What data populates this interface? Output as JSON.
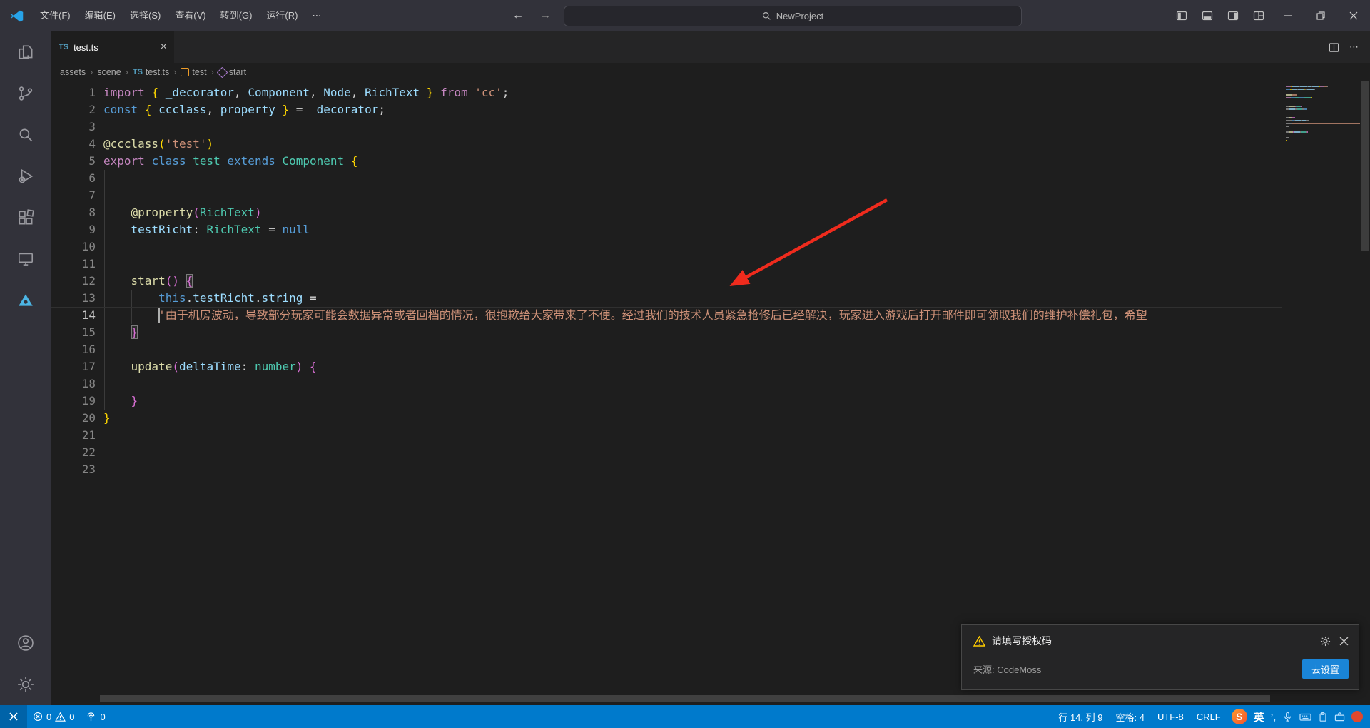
{
  "window": {
    "menus": [
      "文件(F)",
      "编辑(E)",
      "选择(S)",
      "查看(V)",
      "转到(G)",
      "运行(R)"
    ],
    "menu_overflow": "⋯",
    "command_center": "NewProject"
  },
  "tab": {
    "label": "test.ts",
    "icon": "TS"
  },
  "editor_actions": {
    "more": "⋯"
  },
  "breadcrumbs": {
    "items": [
      {
        "label": "assets"
      },
      {
        "label": "scene"
      },
      {
        "label": "test.ts",
        "icon": "ts"
      },
      {
        "label": "test",
        "icon": "class"
      },
      {
        "label": "start",
        "icon": "method"
      }
    ]
  },
  "editor": {
    "current_line": 14,
    "cursor_col": 8,
    "lines": [
      {
        "n": 1,
        "t": [
          [
            "ctrl",
            "import "
          ],
          [
            "b1",
            "{"
          ],
          [
            "v",
            " _decorator"
          ],
          [
            "p",
            ","
          ],
          [
            "v",
            " Component"
          ],
          [
            "p",
            ","
          ],
          [
            "v",
            " Node"
          ],
          [
            "p",
            ","
          ],
          [
            "v",
            " RichText "
          ],
          [
            "b1",
            "}"
          ],
          [
            "ctrl",
            " from "
          ],
          [
            "s",
            "'cc'"
          ],
          [
            "p",
            ";"
          ]
        ]
      },
      {
        "n": 2,
        "t": [
          [
            "kw",
            "const "
          ],
          [
            "b1",
            "{ "
          ],
          [
            "v",
            "ccclass"
          ],
          [
            "p",
            ", "
          ],
          [
            "v",
            "property"
          ],
          [
            "b1",
            " }"
          ],
          [
            "p",
            " = "
          ],
          [
            "v",
            "_decorator"
          ],
          [
            "p",
            ";"
          ]
        ]
      },
      {
        "n": 3,
        "t": []
      },
      {
        "n": 4,
        "t": [
          [
            "fn",
            "@ccclass"
          ],
          [
            "b1",
            "("
          ],
          [
            "s",
            "'test'"
          ],
          [
            "b1",
            ")"
          ]
        ]
      },
      {
        "n": 5,
        "t": [
          [
            "ctrl",
            "export "
          ],
          [
            "kw",
            "class "
          ],
          [
            "ty",
            "test "
          ],
          [
            "kw",
            "extends "
          ],
          [
            "ty",
            "Component "
          ],
          [
            "b1",
            "{"
          ]
        ]
      },
      {
        "n": 6,
        "t": []
      },
      {
        "n": 7,
        "t": []
      },
      {
        "n": 8,
        "t": [
          [
            "p",
            "    "
          ],
          [
            "fn",
            "@property"
          ],
          [
            "b2",
            "("
          ],
          [
            "ty",
            "RichText"
          ],
          [
            "b2",
            ")"
          ]
        ]
      },
      {
        "n": 9,
        "t": [
          [
            "p",
            "    "
          ],
          [
            "v",
            "testRicht"
          ],
          [
            "p",
            ": "
          ],
          [
            "ty",
            "RichText"
          ],
          [
            "p",
            " = "
          ],
          [
            "kw",
            "null"
          ]
        ]
      },
      {
        "n": 10,
        "t": []
      },
      {
        "n": 11,
        "t": []
      },
      {
        "n": 12,
        "t": [
          [
            "p",
            "    "
          ],
          [
            "fn",
            "start"
          ],
          [
            "b2",
            "()"
          ],
          [
            "p",
            " "
          ],
          [
            "b2",
            "{",
            1
          ]
        ]
      },
      {
        "n": 13,
        "t": [
          [
            "p",
            "        "
          ],
          [
            "kw",
            "this"
          ],
          [
            "p",
            "."
          ],
          [
            "v",
            "testRicht"
          ],
          [
            "p",
            "."
          ],
          [
            "v",
            "string"
          ],
          [
            "p",
            " = "
          ]
        ]
      },
      {
        "n": 14,
        "t": [
          [
            "p",
            "        "
          ],
          [
            "s",
            "'由于机房波动，导致部分玩家可能会数据异常或者回档的情况，很抱歉给大家带来了不便。经过我们的技术人员紧急抢修后已经解决，玩家进入游戏后打开邮件即可领取我们的维护补偿礼包，希望"
          ]
        ]
      },
      {
        "n": 15,
        "t": [
          [
            "p",
            "    "
          ],
          [
            "b2",
            "}",
            1
          ]
        ]
      },
      {
        "n": 16,
        "t": []
      },
      {
        "n": 17,
        "t": [
          [
            "p",
            "    "
          ],
          [
            "fn",
            "update"
          ],
          [
            "b2",
            "("
          ],
          [
            "v",
            "deltaTime"
          ],
          [
            "p",
            ": "
          ],
          [
            "ty",
            "number"
          ],
          [
            "b2",
            ")"
          ],
          [
            "p",
            " "
          ],
          [
            "b2",
            "{"
          ]
        ]
      },
      {
        "n": 18,
        "t": []
      },
      {
        "n": 19,
        "t": [
          [
            "p",
            "    "
          ],
          [
            "b2",
            "}"
          ]
        ]
      },
      {
        "n": 20,
        "t": [
          [
            "b1",
            "}"
          ]
        ]
      },
      {
        "n": 21,
        "t": []
      },
      {
        "n": 22,
        "t": []
      },
      {
        "n": 23,
        "t": []
      }
    ]
  },
  "notification": {
    "title": "请填写授权码",
    "source": "来源: CodeMoss",
    "action": "去设置"
  },
  "status_bar": {
    "errors": "0",
    "warnings": "0",
    "ports": "0",
    "cursor_position": "行 14, 列 9",
    "indentation": "空格: 4",
    "encoding": "UTF-8",
    "eol": "CRLF",
    "ime_lang": "英",
    "ime_punct": "’,"
  },
  "colors": {
    "status_bar": "#007acc",
    "annotation_arrow": "#ef2b1d",
    "warning_icon": "#ffcc02",
    "accent_button": "#1a85d8"
  }
}
